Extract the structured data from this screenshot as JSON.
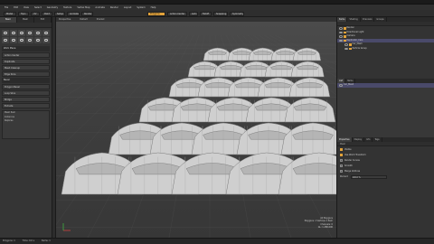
{
  "app": {
    "title": "Default Layout"
  },
  "menus": [
    "File",
    "Edit",
    "View",
    "Select",
    "Geometry",
    "Texture",
    "Vertex Map",
    "Animate",
    "Render",
    "Layout",
    "System",
    "Help"
  ],
  "toolbar": {
    "buttons": [
      {
        "label": "Model",
        "active": false
      },
      {
        "label": "Topo",
        "active": false
      },
      {
        "label": "UV",
        "active": false
      },
      {
        "label": "Paint",
        "active": false
      },
      {
        "label": "Setup",
        "active": false
      },
      {
        "label": "Animate",
        "active": false
      },
      {
        "label": "Render",
        "active": false
      },
      {
        "label": "Polygons",
        "active": true
      },
      {
        "label": "Action Center",
        "active": false
      },
      {
        "label": "Auto",
        "active": false
      },
      {
        "label": "Falloff",
        "active": false
      },
      {
        "label": "Snapping",
        "active": false
      },
      {
        "label": "Symmetry",
        "active": false
      }
    ]
  },
  "left_panel": {
    "tabs": [
      "Basic",
      "Mesh",
      "Edit"
    ],
    "rows": [
      "Work Plane",
      "Action Center",
      "Duplicate",
      "Mesh Cleanup",
      "Edge Slice",
      "Bevel",
      "Polygon Bevel",
      "Loop Slice",
      "Bridge",
      "Extrude"
    ],
    "list_items": [
      "Mesh Item",
      "Instances",
      "Replicas"
    ]
  },
  "viewport": {
    "header": [
      "Perspective",
      "Default",
      "Shaded"
    ],
    "info": [
      "All Polygons",
      "Polygons: 1 Vertices 1 Item",
      "Channels: 0",
      "GL: 1,280,000"
    ]
  },
  "right_panel": {
    "tabs": [
      "Items",
      "Shading",
      "Channels",
      "Groups"
    ],
    "tree": [
      {
        "label": "Render",
        "sel": false
      },
      {
        "label": "Directional Light",
        "sel": false
      },
      {
        "label": "Camera",
        "sel": false
      },
      {
        "label": "Replicator_Cars",
        "sel": true
      },
      {
        "label": "Car_Mesh",
        "sel": false
      },
      {
        "label": "Particle Group",
        "sel": false
      }
    ],
    "sub_tabs": [
      "List",
      "Items"
    ],
    "sub_tree": [
      "Car_Mesh"
    ],
    "properties_tabs": [
      "Properties",
      "Display",
      "Info",
      "Tags"
    ],
    "properties_head": "Mesh",
    "props": [
      {
        "label": "Visible",
        "on": true
      },
      {
        "label": "Use World Transform",
        "on": true
      },
      {
        "label": "Render Curves",
        "on": false
      },
      {
        "label": "Smooth",
        "on": false
      },
      {
        "label": "Merge Vertices",
        "on": false
      }
    ],
    "field_label": "Percent",
    "field_value": "100.0 %"
  },
  "status": [
    "Polygons: 1",
    "Time: 0.0 s",
    "Items: 1"
  ]
}
